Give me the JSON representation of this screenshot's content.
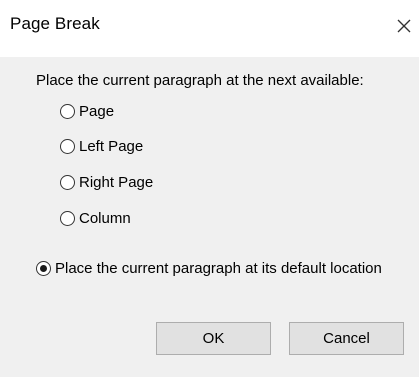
{
  "window": {
    "title": "Page Break"
  },
  "dialog": {
    "heading": "Place the current paragraph at the next available:",
    "options": [
      {
        "label": "Page",
        "checked": false
      },
      {
        "label": "Left Page",
        "checked": false
      },
      {
        "label": "Right Page",
        "checked": false
      },
      {
        "label": "Column",
        "checked": false
      }
    ],
    "default_option": {
      "label": "Place the current paragraph at its default location",
      "checked": true
    }
  },
  "buttons": {
    "ok_label": "OK",
    "cancel_label": "Cancel"
  },
  "icons": {
    "close": "close-icon"
  }
}
